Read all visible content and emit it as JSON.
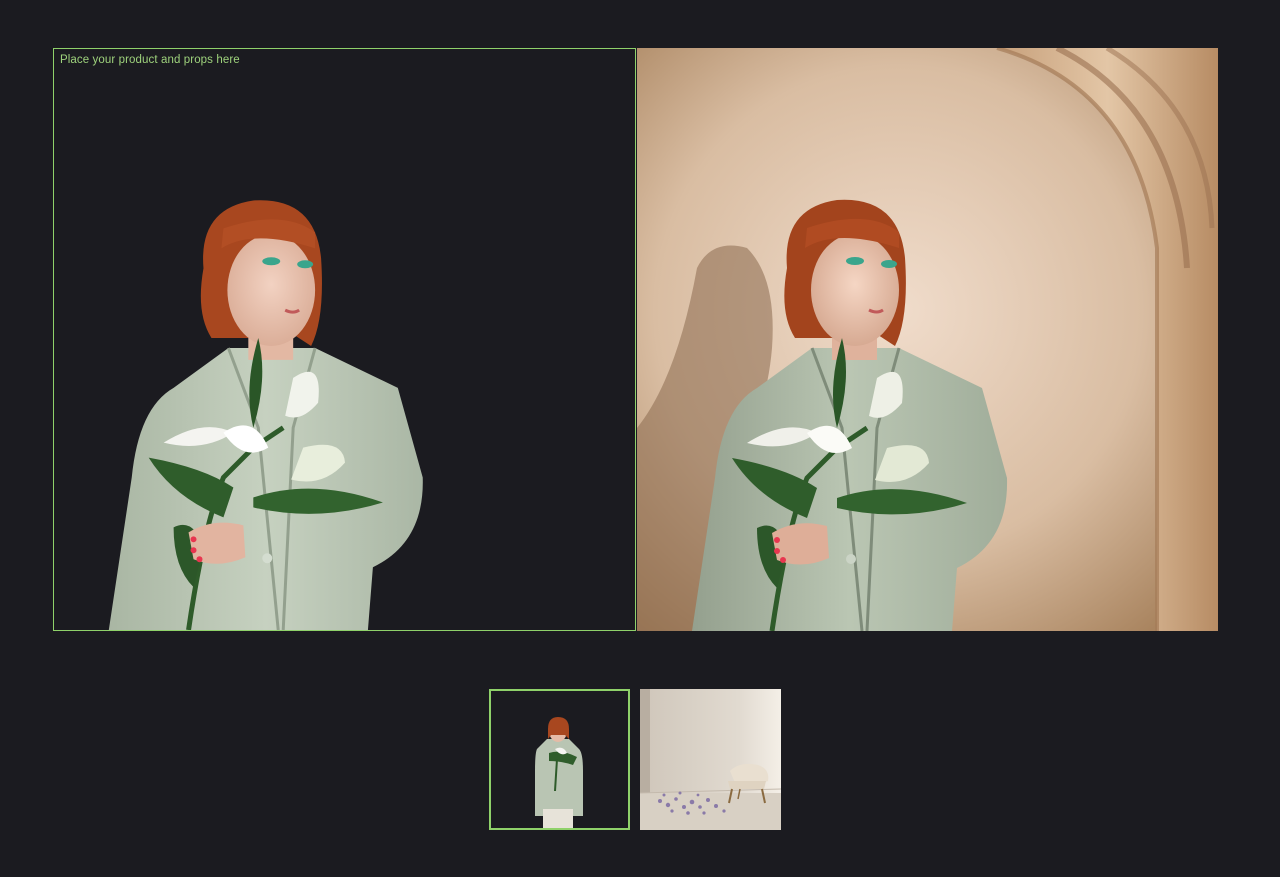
{
  "editor": {
    "hint_text": "Place your product and props here"
  },
  "colors": {
    "accent": "#8fd16a",
    "background": "#1b1b20"
  },
  "thumbnails": [
    {
      "name": "model-cutout",
      "selected": true
    },
    {
      "name": "room-with-chair",
      "selected": false
    }
  ]
}
